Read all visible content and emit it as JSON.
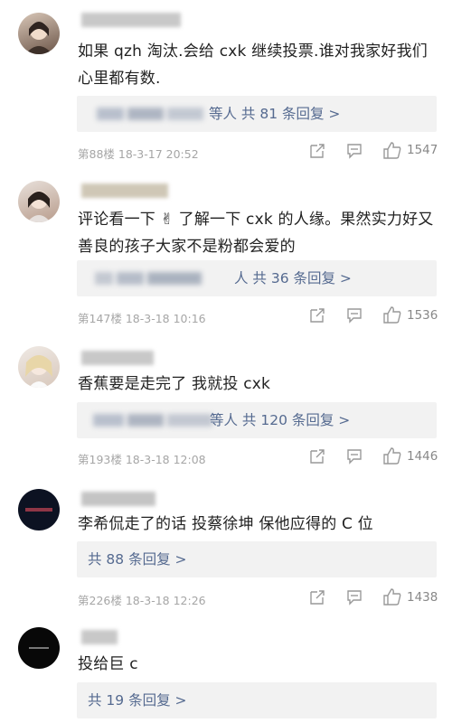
{
  "comments": [
    {
      "text": "如果 qzh 淘汰.会给 cxk 继续投票.谁对我家好我们心里都有数.",
      "reply_text": "等人  共 81 条回复 >",
      "floor": "第88楼",
      "time": "18-3-17 20:52",
      "likes": "1547"
    },
    {
      "text": "评论看一下 ✌ 了解一下 cxk 的人缘。果然实力好又善良的孩子大家不是粉都会爱的",
      "reply_text": "人  共 36 条回复 >",
      "floor": "第147楼",
      "time": "18-3-18 10:16",
      "likes": "1536"
    },
    {
      "text": "香蕉要是走完了 我就投 cxk",
      "reply_text": "等人  共 120 条回复 >",
      "floor": "第193楼",
      "time": "18-3-18 12:08",
      "likes": "1446"
    },
    {
      "text": "李希侃走了的话   投蔡徐坤  保他应得的 C 位",
      "reply_text": "共 88 条回复 >",
      "floor": "第226楼",
      "time": "18-3-18 12:26",
      "likes": "1438"
    },
    {
      "text": "投给巨 c",
      "reply_text": "共 19 条回复 >"
    }
  ],
  "colors": {
    "reply_link": "#556a90",
    "reply_bg": "#f2f2f2",
    "meta_gray": "#a6a6a6"
  },
  "icons": [
    "share-icon",
    "comment-icon",
    "like-icon"
  ]
}
